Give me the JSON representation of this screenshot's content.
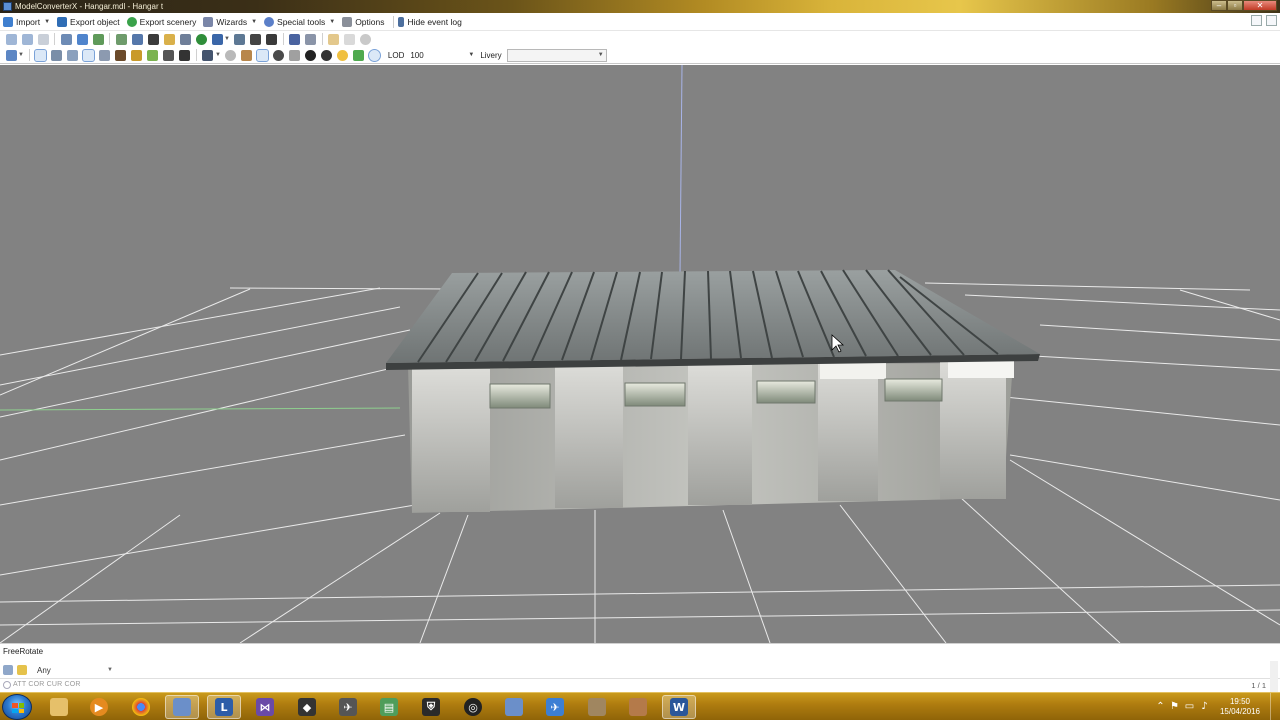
{
  "window": {
    "title": "ModelConverterX - Hangar.mdl - Hangar t",
    "minimize_icon": "minimize-icon",
    "maximize_icon": "maximize-icon",
    "close_icon": "close-icon"
  },
  "menubar": {
    "items": [
      {
        "label": "Import",
        "icon": "import-icon",
        "has_dropdown": true
      },
      {
        "label": "Export object",
        "icon": "export-object-icon",
        "has_dropdown": false
      },
      {
        "label": "Export scenery",
        "icon": "globe-icon",
        "has_dropdown": false
      },
      {
        "label": "Wizards",
        "icon": "wand-icon",
        "has_dropdown": true
      },
      {
        "label": "Special tools",
        "icon": "special-tools-icon",
        "has_dropdown": true
      },
      {
        "label": "Options",
        "icon": "gear-icon",
        "has_dropdown": false
      },
      {
        "label": "Hide event log",
        "icon": "event-log-icon",
        "has_dropdown": false
      }
    ]
  },
  "toolbar2": {
    "lod_label": "LOD",
    "lod_value": "100",
    "livery_label": "Livery",
    "livery_value": ""
  },
  "status": {
    "mode_text": "FreeRotate"
  },
  "filter": {
    "selected": "Any"
  },
  "hint": {
    "text": "ATT COR  CUR COR",
    "page_count": "1 / 1"
  },
  "clock": {
    "time": "19:50",
    "date": "15/04/2016"
  },
  "colors": {
    "viewport_bg": "#828282",
    "grid_line": "#f2f2f2",
    "taskbar": "#b07d10"
  }
}
